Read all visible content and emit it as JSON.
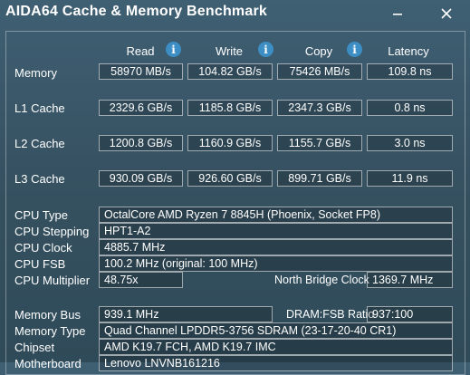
{
  "window": {
    "title": "AIDA64 Cache & Memory Benchmark"
  },
  "columns": {
    "read": "Read",
    "write": "Write",
    "copy": "Copy",
    "latency": "Latency",
    "info_glyph": "i"
  },
  "bench_rows": [
    {
      "label": "Memory",
      "read": "58970 MB/s",
      "write": "104.82 GB/s",
      "copy": "75426 MB/s",
      "latency": "109.8 ns"
    },
    {
      "label": "L1 Cache",
      "read": "2329.6 GB/s",
      "write": "1185.8 GB/s",
      "copy": "2347.3 GB/s",
      "latency": "0.8 ns"
    },
    {
      "label": "L2 Cache",
      "read": "1200.8 GB/s",
      "write": "1160.9 GB/s",
      "copy": "1155.7 GB/s",
      "latency": "3.0 ns"
    },
    {
      "label": "L3 Cache",
      "read": "930.09 GB/s",
      "write": "926.60 GB/s",
      "copy": "899.71 GB/s",
      "latency": "11.9 ns"
    }
  ],
  "cpu": {
    "type_label": "CPU Type",
    "type_value": "OctalCore AMD Ryzen 7 8845H  (Phoenix, Socket FP8)",
    "stepping_label": "CPU Stepping",
    "stepping_value": "HPT1-A2",
    "clock_label": "CPU Clock",
    "clock_value": "4885.7 MHz",
    "fsb_label": "CPU FSB",
    "fsb_value": "100.2 MHz  (original: 100 MHz)",
    "multiplier_label": "CPU Multiplier",
    "multiplier_value": "48.75x",
    "nb_clock_label": "North Bridge Clock",
    "nb_clock_value": "1369.7 MHz"
  },
  "memory": {
    "bus_label": "Memory Bus",
    "bus_value": "939.1 MHz",
    "ratio_label": "DRAM:FSB Ratio",
    "ratio_value": "937:100",
    "type_label": "Memory Type",
    "type_value": "Quad Channel LPDDR5-3756 SDRAM  (23-17-20-40 CR1)",
    "chipset_label": "Chipset",
    "chipset_value": "AMD K19.7 FCH, AMD K19.7 IMC",
    "mobo_label": "Motherboard",
    "mobo_value": "Lenovo LNVNB161216"
  },
  "colors": {
    "background": "#3a5668",
    "info_icon": "#3c8ec4",
    "text": "#ffffff"
  },
  "icons": {
    "minimize": "minimize-icon",
    "close": "close-icon",
    "info": "info-icon"
  }
}
